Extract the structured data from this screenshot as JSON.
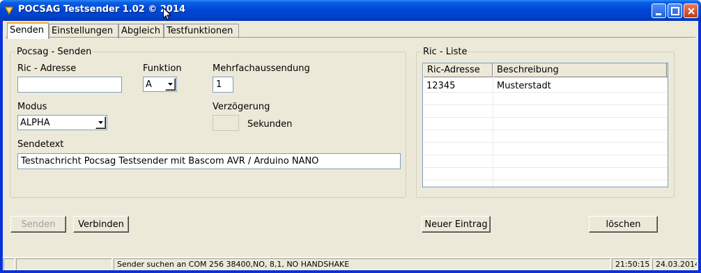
{
  "window": {
    "title": "POCSAG Testsender 1.02 © 2014",
    "controls": [
      "minimize-icon",
      "maximize-icon",
      "close-icon"
    ]
  },
  "tabs": [
    {
      "label": "Senden",
      "active": true
    },
    {
      "label": "Einstellungen",
      "active": false
    },
    {
      "label": "Abgleich",
      "active": false
    },
    {
      "label": "Testfunktionen",
      "active": false
    }
  ],
  "send_group": {
    "title": "Pocsag - Senden",
    "ric_label": "Ric - Adresse",
    "ric_value": "",
    "function_label": "Funktion",
    "function_value": "A",
    "multi_label": "Mehrfachaussendung",
    "multi_value": "1",
    "mode_label": "Modus",
    "mode_value": "ALPHA",
    "delay_label": "Verzögerung",
    "delay_value": "",
    "delay_unit": "Sekunden",
    "text_label": "Sendetext",
    "text_value": "Testnachricht Pocsag Testsender mit Bascom AVR / Arduino NANO"
  },
  "ric_list": {
    "title": "Ric - Liste",
    "columns": [
      "Ric-Adresse",
      "Beschreibung"
    ],
    "rows": [
      [
        "12345",
        "Musterstadt"
      ]
    ]
  },
  "buttons": {
    "send": "Senden",
    "connect": "Verbinden",
    "new_entry": "Neuer Eintrag",
    "delete": "löschen"
  },
  "status": {
    "message": "Sender suchen an COM 256 38400,NO, 8,1, NO HANDSHAKE",
    "time": "21:50:15",
    "date": "24.03.2014"
  },
  "colors": {
    "title_bar": "#0047d8",
    "face": "#ece9d8",
    "active_tab_accent": "#f8a823"
  }
}
